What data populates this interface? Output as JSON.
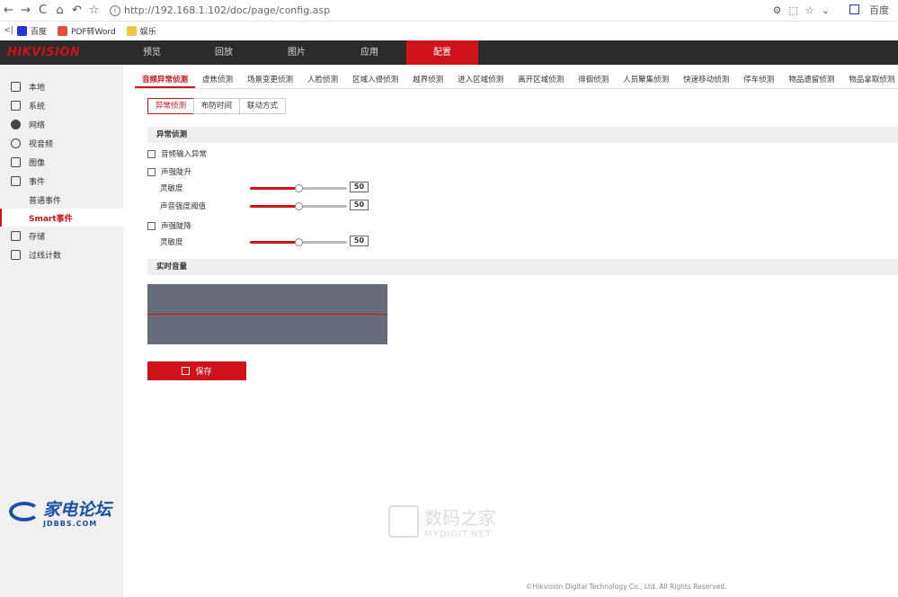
{
  "browser": {
    "url": "http://192.168.1.102/doc/page/config.asp",
    "search_engine": "百度",
    "bookmarks": [
      {
        "label": "百度",
        "color": "#2932e1"
      },
      {
        "label": "PDF转Word",
        "color": "#e84a3c"
      },
      {
        "label": "娱乐",
        "color": "#f5c342"
      }
    ]
  },
  "topnav": {
    "logo": "HIKVISION",
    "items": [
      "预览",
      "回放",
      "图片",
      "应用",
      "配置"
    ],
    "active_index": 4
  },
  "sidebar": {
    "items": [
      {
        "label": "本地",
        "icon": "monitor-icon"
      },
      {
        "label": "系统",
        "icon": "system-icon"
      },
      {
        "label": "网络",
        "icon": "globe-icon"
      },
      {
        "label": "视音频",
        "icon": "video-audio-icon"
      },
      {
        "label": "图像",
        "icon": "image-icon"
      },
      {
        "label": "事件",
        "icon": "event-icon"
      }
    ],
    "event_sub": [
      "普通事件",
      "Smart事件"
    ],
    "after_items": [
      {
        "label": "存储",
        "icon": "storage-icon"
      },
      {
        "label": "过线计数",
        "icon": "line-count-icon"
      }
    ]
  },
  "tabs": [
    "音频异常侦测",
    "虚焦侦测",
    "场景变更侦测",
    "人脸侦测",
    "区域入侵侦测",
    "越界侦测",
    "进入区域侦测",
    "离开区域侦测",
    "徘徊侦测",
    "人员聚集侦测",
    "快速移动侦测",
    "停车侦测",
    "物品遗留侦测",
    "物品拿取侦测"
  ],
  "subtabs": [
    "异常侦测",
    "布防时间",
    "联动方式"
  ],
  "section1": "异常侦测",
  "checks": [
    "音频输入异常",
    "声强陡升",
    "声强陡降"
  ],
  "sliders": [
    {
      "label": "灵敏度",
      "value": "50",
      "fraction": 0.5
    },
    {
      "label": "声音强度阈值",
      "value": "50",
      "fraction": 0.5
    },
    {
      "label": "灵敏度",
      "value": "50",
      "fraction": 0.5
    }
  ],
  "section2": "实时音量",
  "save_label": "保存",
  "footer": "©Hikvision Digital Technology Co., Ltd. All Rights Reserved.",
  "watermark": {
    "big": "数码之家",
    "small": "MYDIGIT.NET"
  },
  "forum_logo": {
    "big": "家电论坛",
    "small": "JDBBS.COM"
  }
}
